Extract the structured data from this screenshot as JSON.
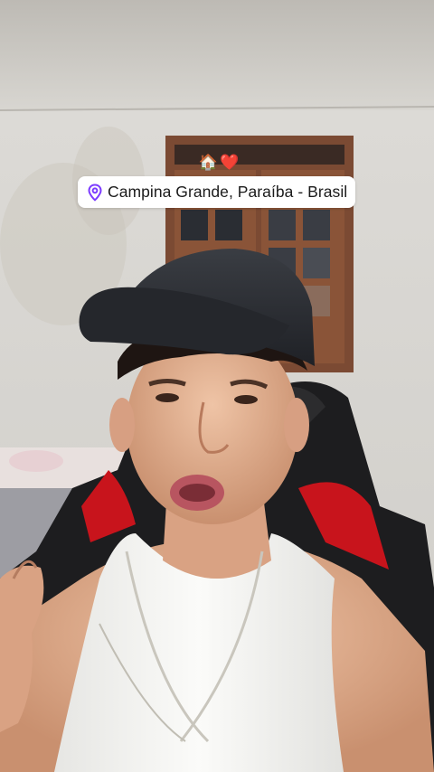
{
  "sticker": {
    "emoji": [
      "🏠",
      "❤️"
    ],
    "location_text": "Campina Grande, Paraíba - Brasil",
    "pin_icon": "location-pin-icon",
    "pin_color": "#7d3cff"
  },
  "colors": {
    "wall": "#d9d7d2",
    "ceiling": "#c9c7c2",
    "window_frame": "#7b4a33",
    "cap": "#2b2e33",
    "chair_black": "#1d1d1f",
    "chair_red": "#c8141c",
    "tank_top": "#f2f2f0",
    "skin": "#e7b89b"
  }
}
